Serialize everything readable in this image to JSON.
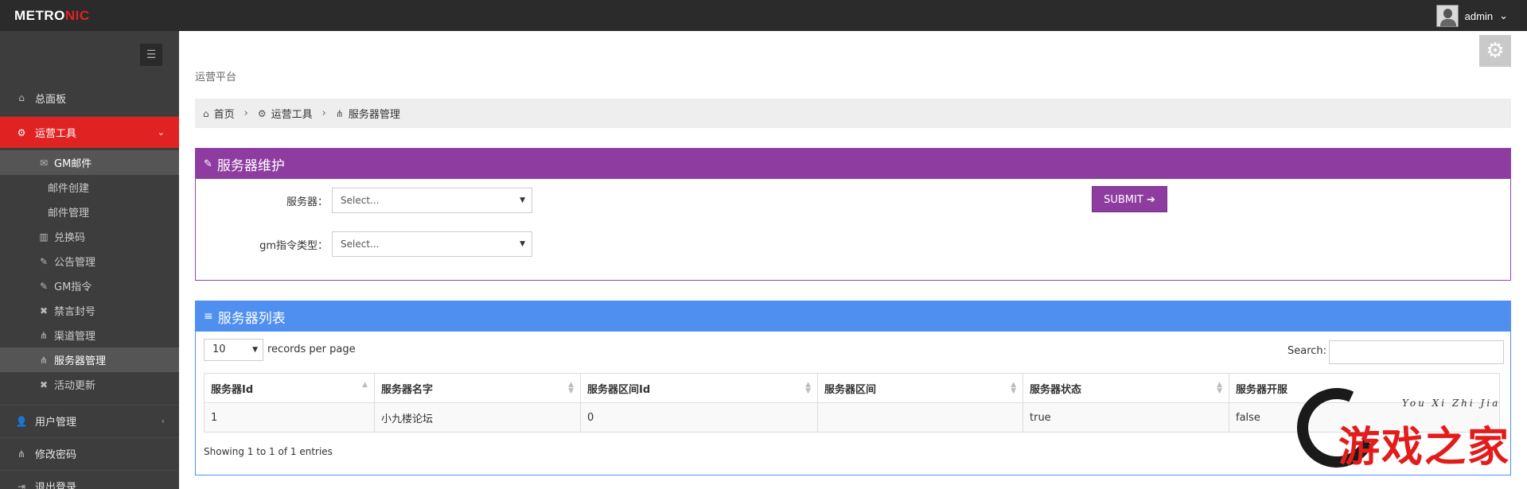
{
  "header": {
    "logo_main": "METRO",
    "logo_accent": "NIC",
    "username": "admin",
    "user_caret": "⌄"
  },
  "sidebar": {
    "toggle_glyph": "☰",
    "dashboard": "总面板",
    "ops_tools": "运营工具",
    "gm_mail": "GM邮件",
    "mail_create": "邮件创建",
    "mail_manage": "邮件管理",
    "redeem_code": "兑换码",
    "notice_manage": "公告管理",
    "gm_command": "GM指令",
    "ban_account": "禁言封号",
    "channel_manage": "渠道管理",
    "server_manage": "服务器管理",
    "activity_update": "活动更新",
    "user_manage": "用户管理",
    "change_password": "修改密码",
    "logout": "退出登录"
  },
  "page": {
    "title": "运营平台",
    "breadcrumb": [
      "首页",
      "运营工具",
      "服务器管理"
    ]
  },
  "maintenance": {
    "title": "服务器维护",
    "server_label": "服务器：",
    "server_value": "Select...",
    "gm_type_label": "gm指令类型：",
    "gm_type_value": "Select...",
    "submit": "SUBMIT"
  },
  "server_list": {
    "title": "服务器列表",
    "page_length": "10",
    "records_label": "records per page",
    "search_label": "Search:",
    "columns": [
      "服务器Id",
      "服务器名字",
      "服务器区间Id",
      "服务器区间",
      "服务器状态",
      "服务器开服"
    ],
    "rows": [
      [
        "1",
        "小九楼论坛",
        "0",
        "",
        "true",
        "false"
      ]
    ],
    "info": "Showing 1 to 1 of 1 entries"
  },
  "watermark": {
    "cn": "游戏之家",
    "en": "You Xi Zhi Jia"
  },
  "colors": {
    "sidebar_bg": "#3d3d3d",
    "active_red": "#e02222",
    "purple": "#8e3ca0",
    "blue": "#4f8ff0"
  }
}
